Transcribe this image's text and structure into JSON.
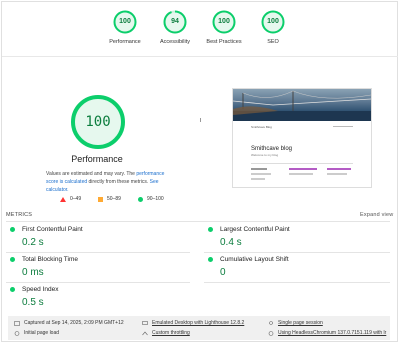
{
  "gauges": [
    {
      "score": "100",
      "label": "Performance"
    },
    {
      "score": "94",
      "label": "Accessibility",
      "fraction": 0.94
    },
    {
      "score": "100",
      "label": "Best Practices"
    },
    {
      "score": "100",
      "label": "SEO"
    }
  ],
  "main": {
    "score": "100",
    "title": "Performance",
    "note_prefix": "Values are estimated and may vary. The ",
    "note_link1": "performance score is calculated",
    "note_mid": " directly from these metrics. ",
    "note_link2": "See calculator."
  },
  "legend": [
    {
      "range": "0–49",
      "color": "#ff3333"
    },
    {
      "range": "50–89",
      "color": "#ffaa33"
    },
    {
      "range": "90–100",
      "color": "#0cce6b"
    }
  ],
  "thumbnail": {
    "nav": "Smithcave Blog",
    "blog_title": "Smithcave blog",
    "subtitle": "Welcome to my blog"
  },
  "metrics": {
    "header": "METRICS",
    "expand": "Expand view",
    "items": [
      {
        "name": "First Contentful Paint",
        "value": "0.2 s"
      },
      {
        "name": "Largest Contentful Paint",
        "value": "0.4 s"
      },
      {
        "name": "Total Blocking Time",
        "value": "0 ms"
      },
      {
        "name": "Cumulative Layout Shift",
        "value": "0"
      },
      {
        "name": "Speed Index",
        "value": "0.5 s"
      }
    ]
  },
  "footer": {
    "captured": "Captured at Sep 14, 2025, 2:09 PM GMT+12",
    "emulated": "Emulated Desktop with Lighthouse 12.8.2",
    "session": "Single page session",
    "initial": "Initial page load",
    "throttling": "Custom throttling",
    "chromium": "Using HeadlessChromium 137.0.7151.119 with lr"
  }
}
